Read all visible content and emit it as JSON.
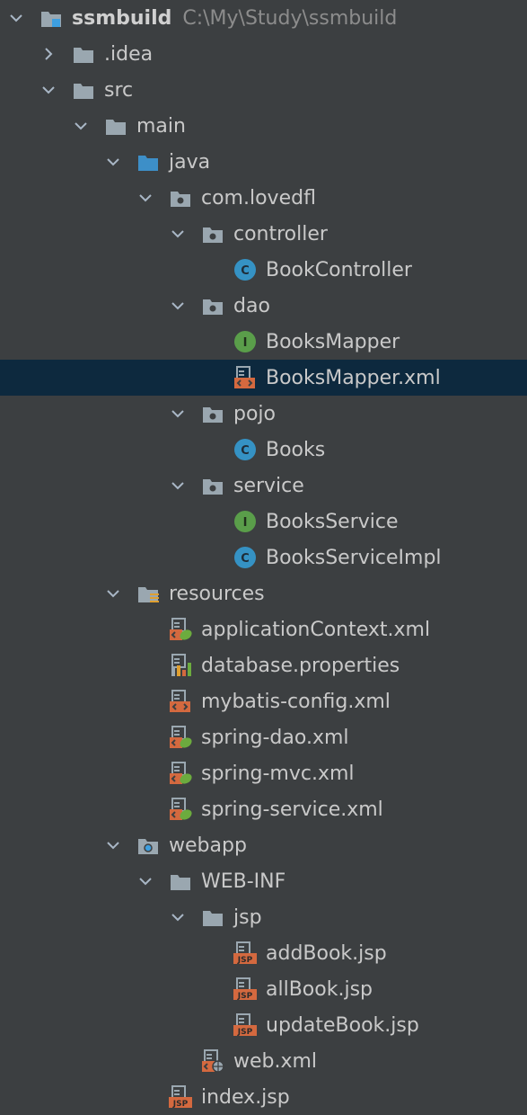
{
  "project": {
    "name": "ssmbuild",
    "path": "C:\\My\\Study\\ssmbuild"
  },
  "tree": [
    {
      "label": "ssmbuild",
      "depth": 0,
      "arrow": "down",
      "icon": "module-folder-icon",
      "kind": "root"
    },
    {
      "label": ".idea",
      "depth": 1,
      "arrow": "right",
      "icon": "folder-icon"
    },
    {
      "label": "src",
      "depth": 1,
      "arrow": "down",
      "icon": "folder-icon"
    },
    {
      "label": "main",
      "depth": 2,
      "arrow": "down",
      "icon": "folder-icon"
    },
    {
      "label": "java",
      "depth": 3,
      "arrow": "down",
      "icon": "source-folder-icon"
    },
    {
      "label": "com.lovedfl",
      "depth": 4,
      "arrow": "down",
      "icon": "package-icon"
    },
    {
      "label": "controller",
      "depth": 5,
      "arrow": "down",
      "icon": "package-icon"
    },
    {
      "label": "BookController",
      "depth": 6,
      "arrow": "none",
      "icon": "class-icon"
    },
    {
      "label": "dao",
      "depth": 5,
      "arrow": "down",
      "icon": "package-icon"
    },
    {
      "label": "BooksMapper",
      "depth": 6,
      "arrow": "none",
      "icon": "interface-icon"
    },
    {
      "label": "BooksMapper.xml",
      "depth": 6,
      "arrow": "none",
      "icon": "xml-file-icon",
      "selected": true
    },
    {
      "label": "pojo",
      "depth": 5,
      "arrow": "down",
      "icon": "package-icon"
    },
    {
      "label": "Books",
      "depth": 6,
      "arrow": "none",
      "icon": "class-icon"
    },
    {
      "label": "service",
      "depth": 5,
      "arrow": "down",
      "icon": "package-icon"
    },
    {
      "label": "BooksService",
      "depth": 6,
      "arrow": "none",
      "icon": "interface-icon"
    },
    {
      "label": "BooksServiceImpl",
      "depth": 6,
      "arrow": "none",
      "icon": "class-icon"
    },
    {
      "label": "resources",
      "depth": 3,
      "arrow": "down",
      "icon": "resources-folder-icon"
    },
    {
      "label": "applicationContext.xml",
      "depth": 4,
      "arrow": "none",
      "icon": "spring-xml-icon"
    },
    {
      "label": "database.properties",
      "depth": 4,
      "arrow": "none",
      "icon": "properties-file-icon"
    },
    {
      "label": "mybatis-config.xml",
      "depth": 4,
      "arrow": "none",
      "icon": "xml-file-icon"
    },
    {
      "label": "spring-dao.xml",
      "depth": 4,
      "arrow": "none",
      "icon": "spring-xml-icon"
    },
    {
      "label": "spring-mvc.xml",
      "depth": 4,
      "arrow": "none",
      "icon": "spring-xml-icon"
    },
    {
      "label": "spring-service.xml",
      "depth": 4,
      "arrow": "none",
      "icon": "spring-xml-icon"
    },
    {
      "label": "webapp",
      "depth": 3,
      "arrow": "down",
      "icon": "web-folder-icon"
    },
    {
      "label": "WEB-INF",
      "depth": 4,
      "arrow": "down",
      "icon": "folder-icon"
    },
    {
      "label": "jsp",
      "depth": 5,
      "arrow": "down",
      "icon": "folder-icon"
    },
    {
      "label": "addBook.jsp",
      "depth": 6,
      "arrow": "none",
      "icon": "jsp-file-icon"
    },
    {
      "label": "allBook.jsp",
      "depth": 6,
      "arrow": "none",
      "icon": "jsp-file-icon"
    },
    {
      "label": "updateBook.jsp",
      "depth": 6,
      "arrow": "none",
      "icon": "jsp-file-icon"
    },
    {
      "label": "web.xml",
      "depth": 5,
      "arrow": "none",
      "icon": "web-xml-icon"
    },
    {
      "label": "index.jsp",
      "depth": 4,
      "arrow": "none",
      "icon": "jsp-file-icon"
    }
  ],
  "colors": {
    "background": "#3c3f41",
    "selection": "#0d293e",
    "folder": "#9aa7b0",
    "source_folder": "#3d8fc8",
    "class": "#3592c4",
    "interface": "#5a9e4a",
    "file_accent": "#d4693f",
    "spring_leaf": "#6cab3e"
  }
}
